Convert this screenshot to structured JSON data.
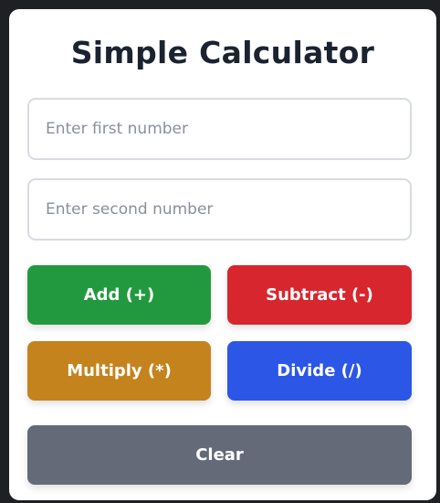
{
  "title": "Simple Calculator",
  "inputs": {
    "first": {
      "value": "",
      "placeholder": "Enter first number"
    },
    "second": {
      "value": "",
      "placeholder": "Enter second number"
    }
  },
  "buttons": {
    "add": {
      "label": "Add (+)",
      "color": "#23993f"
    },
    "subtract": {
      "label": "Subtract (-)",
      "color": "#d8262f"
    },
    "multiply": {
      "label": "Multiply (*)",
      "color": "#c4831d"
    },
    "divide": {
      "label": "Divide (/)",
      "color": "#2c57e6"
    },
    "clear": {
      "label": "Clear",
      "color": "#656a79"
    }
  }
}
